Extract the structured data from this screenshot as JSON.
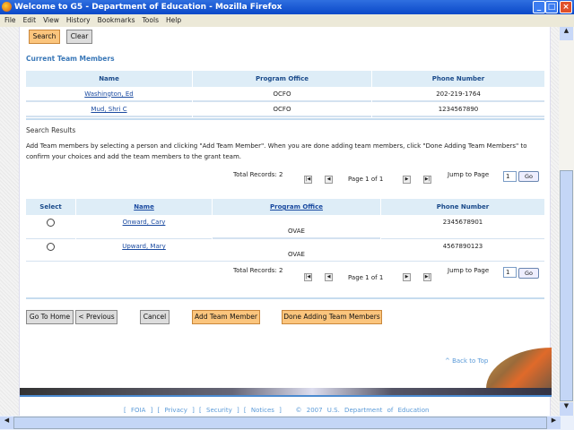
{
  "window": {
    "title": "Welcome to G5 - Department of Education - Mozilla Firefox"
  },
  "menu": [
    "File",
    "Edit",
    "View",
    "History",
    "Bookmarks",
    "Tools",
    "Help"
  ],
  "search": {
    "search_label": "Search",
    "clear_label": "Clear"
  },
  "current": {
    "heading": "Current Team Members",
    "columns": [
      "Name",
      "Program Office",
      "Phone Number"
    ],
    "rows": [
      {
        "name": "Washington, Ed",
        "office": "OCFO",
        "phone": "202-219-1764"
      },
      {
        "name": "Mud, Shri C",
        "office": "OCFO",
        "phone": "1234567890"
      }
    ]
  },
  "results": {
    "heading": "Search Results",
    "instructions": "Add Team members by selecting a person and clicking \"Add Team Member\". When you are done adding team members, click \"Done Adding Team Members\" to confirm your choices and add the team members to the grant team.",
    "total": "Total Records: 2",
    "page": "Page 1 of 1",
    "jump": "Jump to Page",
    "jump_value": "1",
    "go": "Go",
    "columns": [
      "Select",
      "Name",
      "Program Office",
      "Phone Number"
    ],
    "rows": [
      {
        "name": "Onward, Cary",
        "office": "OVAE",
        "phone": "2345678901"
      },
      {
        "name": "Upward, Mary",
        "office": "OVAE",
        "phone": "4567890123"
      }
    ]
  },
  "actions": {
    "home": "Go To Home",
    "previous": "< Previous",
    "cancel": "Cancel",
    "add": "Add Team Member",
    "done": "Done Adding Team Members"
  },
  "back_to_top": "^ Back to Top",
  "footer": {
    "links": [
      "FOIA",
      "Privacy",
      "Security",
      "Notices"
    ],
    "copyright": "© 2007 U.S. Department of Education"
  }
}
